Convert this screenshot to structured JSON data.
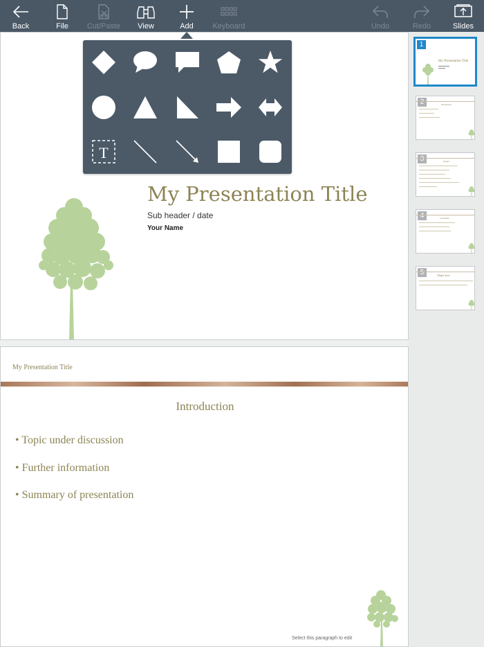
{
  "toolbar": {
    "back": "Back",
    "file": "File",
    "cut_paste": "Cut/Paste",
    "view": "View",
    "add": "Add",
    "keyboard": "Keyboard",
    "undo": "Undo",
    "redo": "Redo",
    "slides": "Slides"
  },
  "shape_panel": {
    "text_box_glyph": "T",
    "shapes": [
      "diamond",
      "speech-bubble-round",
      "speech-bubble-rect",
      "pentagon",
      "star",
      "circle",
      "triangle",
      "right-triangle",
      "arrow-right",
      "arrow-double",
      "text-box",
      "line",
      "arrow-line",
      "square",
      "rounded-square"
    ]
  },
  "slide_main": {
    "title": "My Presentation Title",
    "subheader": "Sub header / date",
    "name": "Your Name"
  },
  "slide_two": {
    "header": "My Presentation Title",
    "title": "Introduction",
    "bullets": [
      "• Topic under discussion",
      "• Further information",
      "• Summary of presentation"
    ],
    "hint": "Select this paragraph to edit"
  },
  "thumbnails": [
    {
      "number": "1",
      "title": "My Presentation Title",
      "selected": true
    },
    {
      "number": "2",
      "title": "Introduction"
    },
    {
      "number": "3",
      "title": "Design"
    },
    {
      "number": "4",
      "title": "Conclusion"
    },
    {
      "number": "5",
      "title": "Thank You!"
    }
  ],
  "colors": {
    "toolbar": "#4a5866",
    "accent": "#1e88c9",
    "title_text": "#8c8455",
    "tree": "#b7d39b"
  }
}
